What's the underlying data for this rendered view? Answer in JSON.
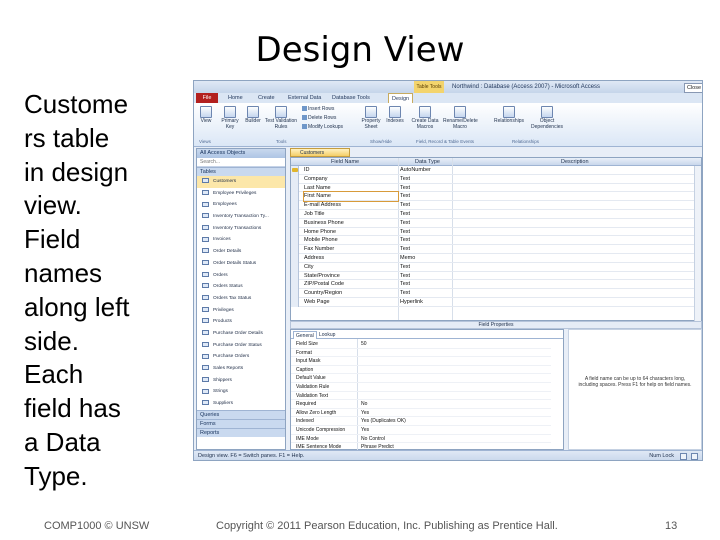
{
  "slide": {
    "title": "Design View",
    "text_lines": [
      "Custome",
      "rs table",
      "in design",
      "view.",
      "Field",
      "names",
      "along left",
      "side.",
      "Each",
      "field has",
      "a Data",
      "Type."
    ],
    "footer_left": "COMP1000 © UNSW",
    "footer_center": "Copyright © 2011 Pearson Education, Inc. Publishing as Prentice Hall.",
    "page_number": "13"
  },
  "window": {
    "context_tab": "Table Tools",
    "title": "Northwind : Database (Access 2007) - Microsoft Access",
    "close_label": "Close"
  },
  "ribbon_tabs": [
    "File",
    "Home",
    "Create",
    "External Data",
    "Database Tools",
    "Design"
  ],
  "ribbon": {
    "view": "View",
    "primary_key": "Primary Key",
    "builder": "Builder",
    "test_rules": "Test Validation Rules",
    "insert_rows": "Insert Rows",
    "delete_rows": "Delete Rows",
    "modify_lookups": "Modify Lookups",
    "property_sheet": "Property Sheet",
    "indexes": "Indexes",
    "create_macros": "Create Data Macros",
    "rename_macro": "Rename/Delete Macro",
    "relationships": "Relationships",
    "object_dependencies": "Object Dependencies",
    "group_views": "Views",
    "group_tools": "Tools",
    "group_showhide": "Show/Hide",
    "group_events": "Field, Record & Table Events",
    "group_relationships": "Relationships"
  },
  "nav_pane": {
    "header": "All Access Objects",
    "search_placeholder": "Search...",
    "tables_section": "Tables",
    "items": [
      "Customers",
      "Employee Privileges",
      "Employees",
      "Inventory Transaction Ty...",
      "Inventory Transactions",
      "Invoices",
      "Order Details",
      "Order Details Status",
      "Orders",
      "Orders Status",
      "Orders Tax Status",
      "Privileges",
      "Products",
      "Purchase Order Details",
      "Purchase Order Status",
      "Purchase Orders",
      "Sales Reports",
      "Shippers",
      "Strings",
      "Suppliers"
    ],
    "queries_section": "Queries",
    "forms_section": "Forms",
    "reports_section": "Reports"
  },
  "document_tab": "Customers",
  "grid": {
    "headers": {
      "field_name": "Field Name",
      "data_type": "Data Type",
      "description": "Description"
    },
    "rows": [
      {
        "field": "ID",
        "type": "AutoNumber"
      },
      {
        "field": "Company",
        "type": "Text"
      },
      {
        "field": "Last Name",
        "type": "Text"
      },
      {
        "field": "First Name",
        "type": "Text"
      },
      {
        "field": "E-mail Address",
        "type": "Text"
      },
      {
        "field": "Job Title",
        "type": "Text"
      },
      {
        "field": "Business Phone",
        "type": "Text"
      },
      {
        "field": "Home Phone",
        "type": "Text"
      },
      {
        "field": "Mobile Phone",
        "type": "Text"
      },
      {
        "field": "Fax Number",
        "type": "Text"
      },
      {
        "field": "Address",
        "type": "Memo"
      },
      {
        "field": "City",
        "type": "Text"
      },
      {
        "field": "State/Province",
        "type": "Text"
      },
      {
        "field": "ZIP/Postal Code",
        "type": "Text"
      },
      {
        "field": "Country/Region",
        "type": "Text"
      },
      {
        "field": "Web Page",
        "type": "Hyperlink"
      }
    ]
  },
  "field_properties_label": "Field Properties",
  "properties": {
    "tab_general": "General",
    "tab_lookup": "Lookup",
    "rows": [
      {
        "label": "Field Size",
        "value": "50"
      },
      {
        "label": "Format",
        "value": ""
      },
      {
        "label": "Input Mask",
        "value": ""
      },
      {
        "label": "Caption",
        "value": ""
      },
      {
        "label": "Default Value",
        "value": ""
      },
      {
        "label": "Validation Rule",
        "value": ""
      },
      {
        "label": "Validation Text",
        "value": ""
      },
      {
        "label": "Required",
        "value": "No"
      },
      {
        "label": "Allow Zero Length",
        "value": "Yes"
      },
      {
        "label": "Indexed",
        "value": "Yes (Duplicates OK)"
      },
      {
        "label": "Unicode Compression",
        "value": "Yes"
      },
      {
        "label": "IME Mode",
        "value": "No Control"
      },
      {
        "label": "IME Sentence Mode",
        "value": "Phrase Predict"
      },
      {
        "label": "Smart Tags",
        "value": ""
      }
    ],
    "help_text": "A field name can be up to 64 characters long, including spaces. Press F1 for help on field names."
  },
  "statusbar": {
    "left": "Design view. F6 = Switch panes. F1 = Help.",
    "right": "Num Lock"
  }
}
